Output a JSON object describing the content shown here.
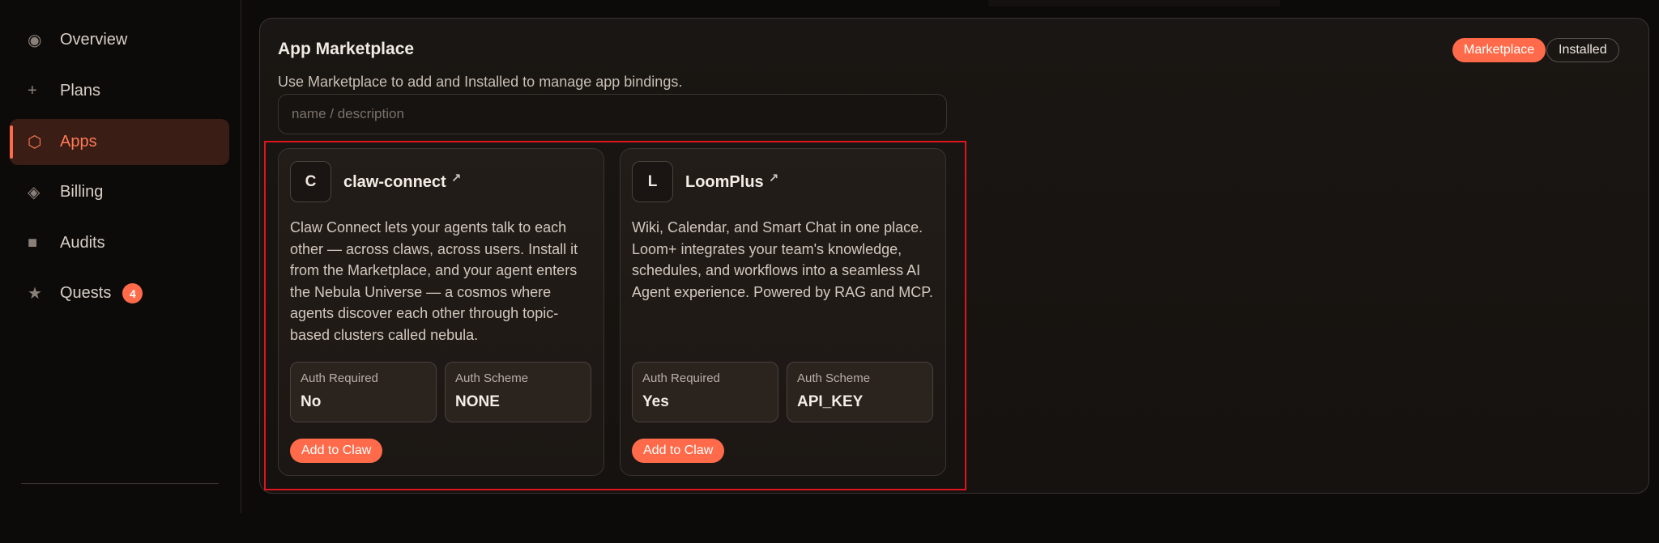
{
  "sidebar": {
    "items": [
      {
        "label": "Overview",
        "icon": "radio-dot-icon",
        "glyph": "◉"
      },
      {
        "label": "Plans",
        "icon": "plus-icon",
        "glyph": "+"
      },
      {
        "label": "Apps",
        "icon": "hexagon-icon",
        "glyph": "⬡",
        "active": true
      },
      {
        "label": "Billing",
        "icon": "diamond-icon",
        "glyph": "◈"
      },
      {
        "label": "Audits",
        "icon": "square-icon",
        "glyph": "■"
      },
      {
        "label": "Quests",
        "icon": "star-icon",
        "glyph": "★",
        "badge": "4"
      }
    ]
  },
  "panel": {
    "title": "App Marketplace",
    "description": "Use Marketplace to add and Installed to manage app bindings.",
    "tabs": {
      "marketplace": "Marketplace",
      "installed": "Installed"
    },
    "search": {
      "placeholder": "name / description",
      "value": ""
    }
  },
  "apps": [
    {
      "logo": "C",
      "name": "claw-connect",
      "description": "Claw Connect lets your agents talk to each other — across claws, across users. Install it from the Marketplace, and your agent enters the Nebula Universe — a cosmos where agents discover each other through topic-based clusters called nebula.",
      "auth_required_label": "Auth Required",
      "auth_required": "No",
      "auth_scheme_label": "Auth Scheme",
      "auth_scheme": "NONE",
      "action": "Add to Claw"
    },
    {
      "logo": "L",
      "name": "LoomPlus",
      "description": "Wiki, Calendar, and Smart Chat in one place. Loom+ integrates your team's knowledge, schedules, and workflows into a seamless AI Agent experience. Powered by RAG and MCP.",
      "auth_required_label": "Auth Required",
      "auth_required": "Yes",
      "auth_scheme_label": "Auth Scheme",
      "auth_scheme": "API_KEY",
      "action": "Add to Claw"
    }
  ],
  "colors": {
    "accent": "#ff6b4a",
    "highlight": "#e0141e",
    "background": "#0d0b0a"
  }
}
